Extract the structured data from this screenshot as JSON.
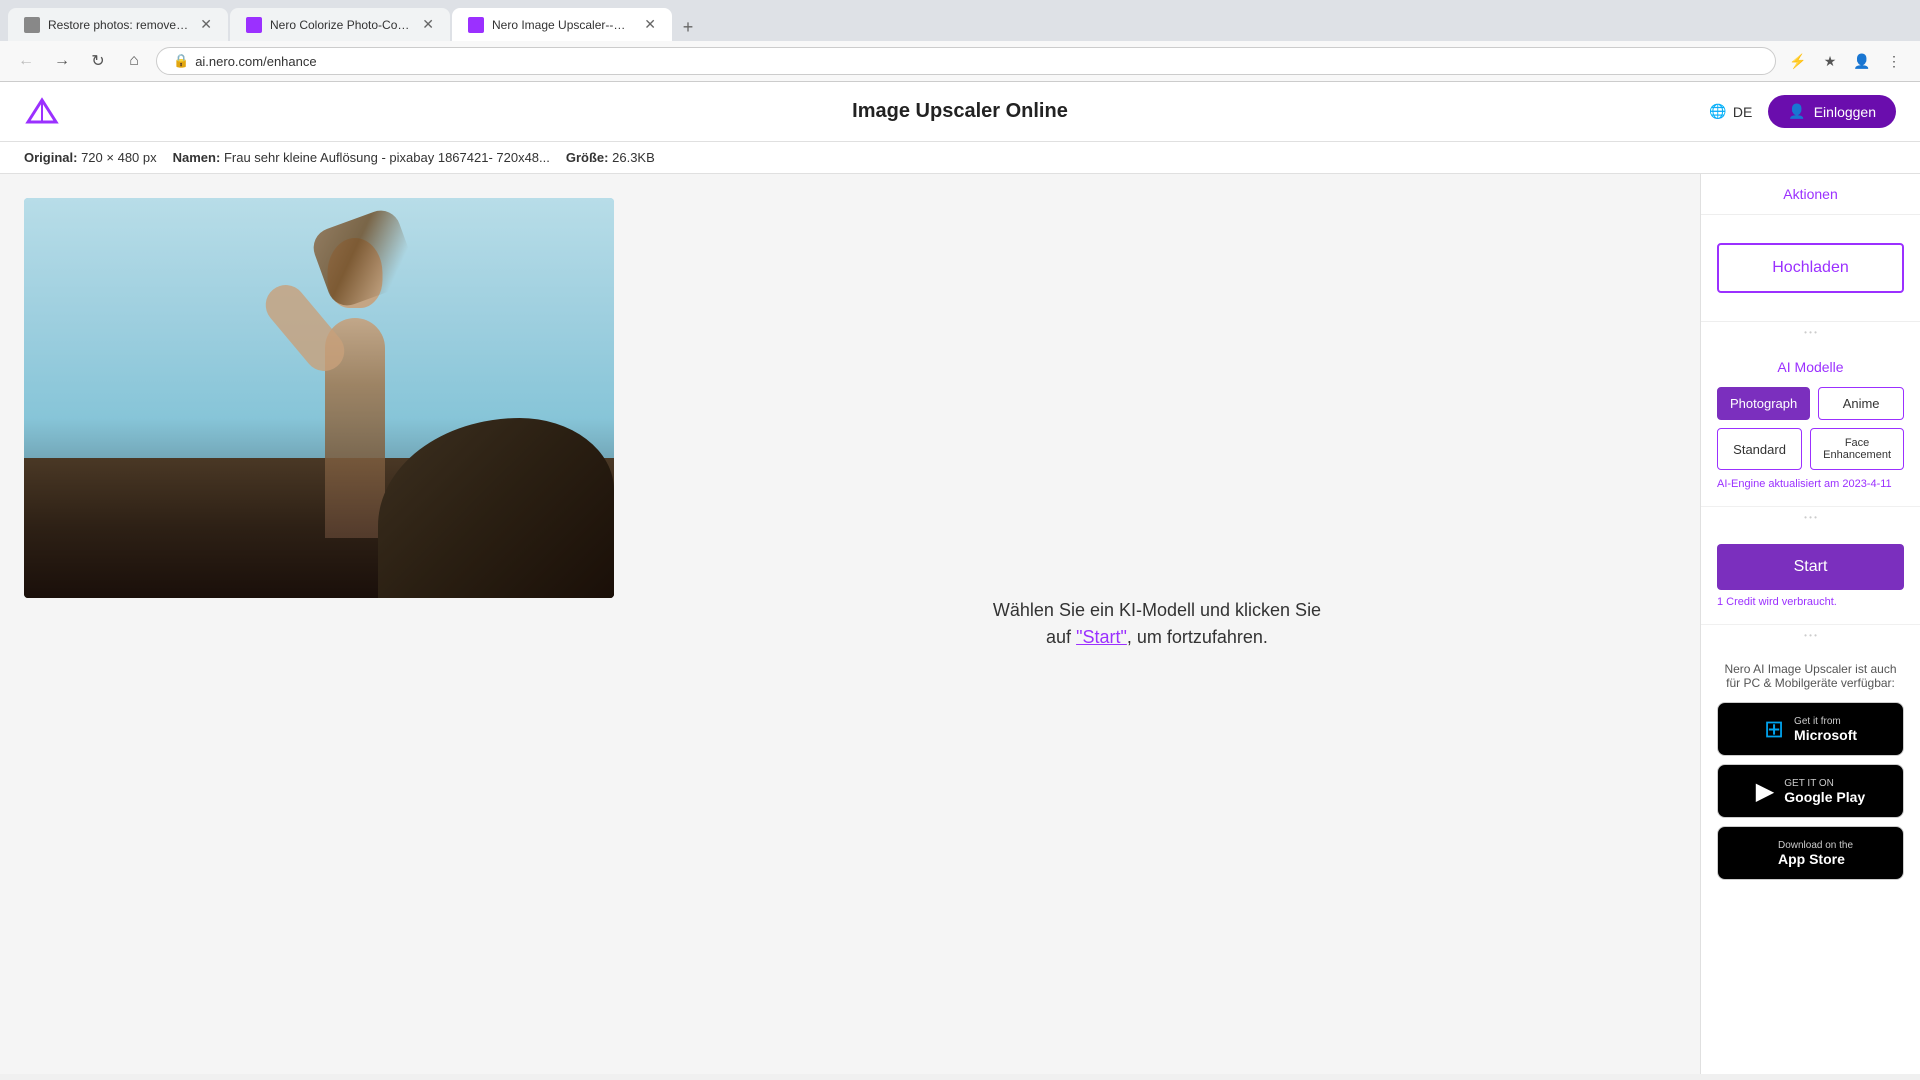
{
  "browser": {
    "tabs": [
      {
        "id": "tab1",
        "label": "Restore photos: remove scratch...",
        "favicon": "photo",
        "active": false
      },
      {
        "id": "tab2",
        "label": "Nero Colorize Photo-Colorize Yo...",
        "favicon": "nero",
        "active": false
      },
      {
        "id": "tab3",
        "label": "Nero Image Upscaler--Free Pho...",
        "favicon": "nero",
        "active": true
      }
    ],
    "address": "ai.nero.com/enhance"
  },
  "app": {
    "title": "Image Upscaler Online",
    "lang": "DE",
    "login_label": "Einloggen"
  },
  "infobar": {
    "original_label": "Original:",
    "original_value": "720 × 480 px",
    "name_label": "Namen:",
    "name_value": "Frau sehr kleine Auflösung - pixabay 1867421- 720x48...",
    "size_label": "Größe:",
    "size_value": "26.3KB"
  },
  "sidebar": {
    "aktionen_label": "Aktionen",
    "hochladen_label": "Hochladen",
    "ai_modelle_label": "AI Modelle",
    "models": [
      {
        "id": "photograph",
        "label": "Photograph",
        "active": true
      },
      {
        "id": "anime",
        "label": "Anime",
        "active": false
      },
      {
        "id": "standard",
        "label": "Standard",
        "active": false
      },
      {
        "id": "face",
        "label": "Face Enhancement",
        "active": false
      }
    ],
    "ai_engine_note": "AI-Engine aktualisiert am 2023-4-11",
    "start_label": "Start",
    "credit_note": "1 Credit wird verbraucht.",
    "download_text": "Nero AI Image Upscaler ist auch für PC & Mobilgeräte verfügbar:",
    "microsoft_small": "Get it from",
    "microsoft_large": "Microsoft",
    "google_small": "GET IT ON",
    "google_large": "Google Play",
    "apple_small": "Download on the",
    "apple_large": "App Store"
  },
  "main": {
    "instruction": "Wählen Sie ein KI-Modell und klicken Sie\nauf ",
    "instruction_link": "\"Start\"",
    "instruction_suffix": ", um fortzufahren."
  }
}
